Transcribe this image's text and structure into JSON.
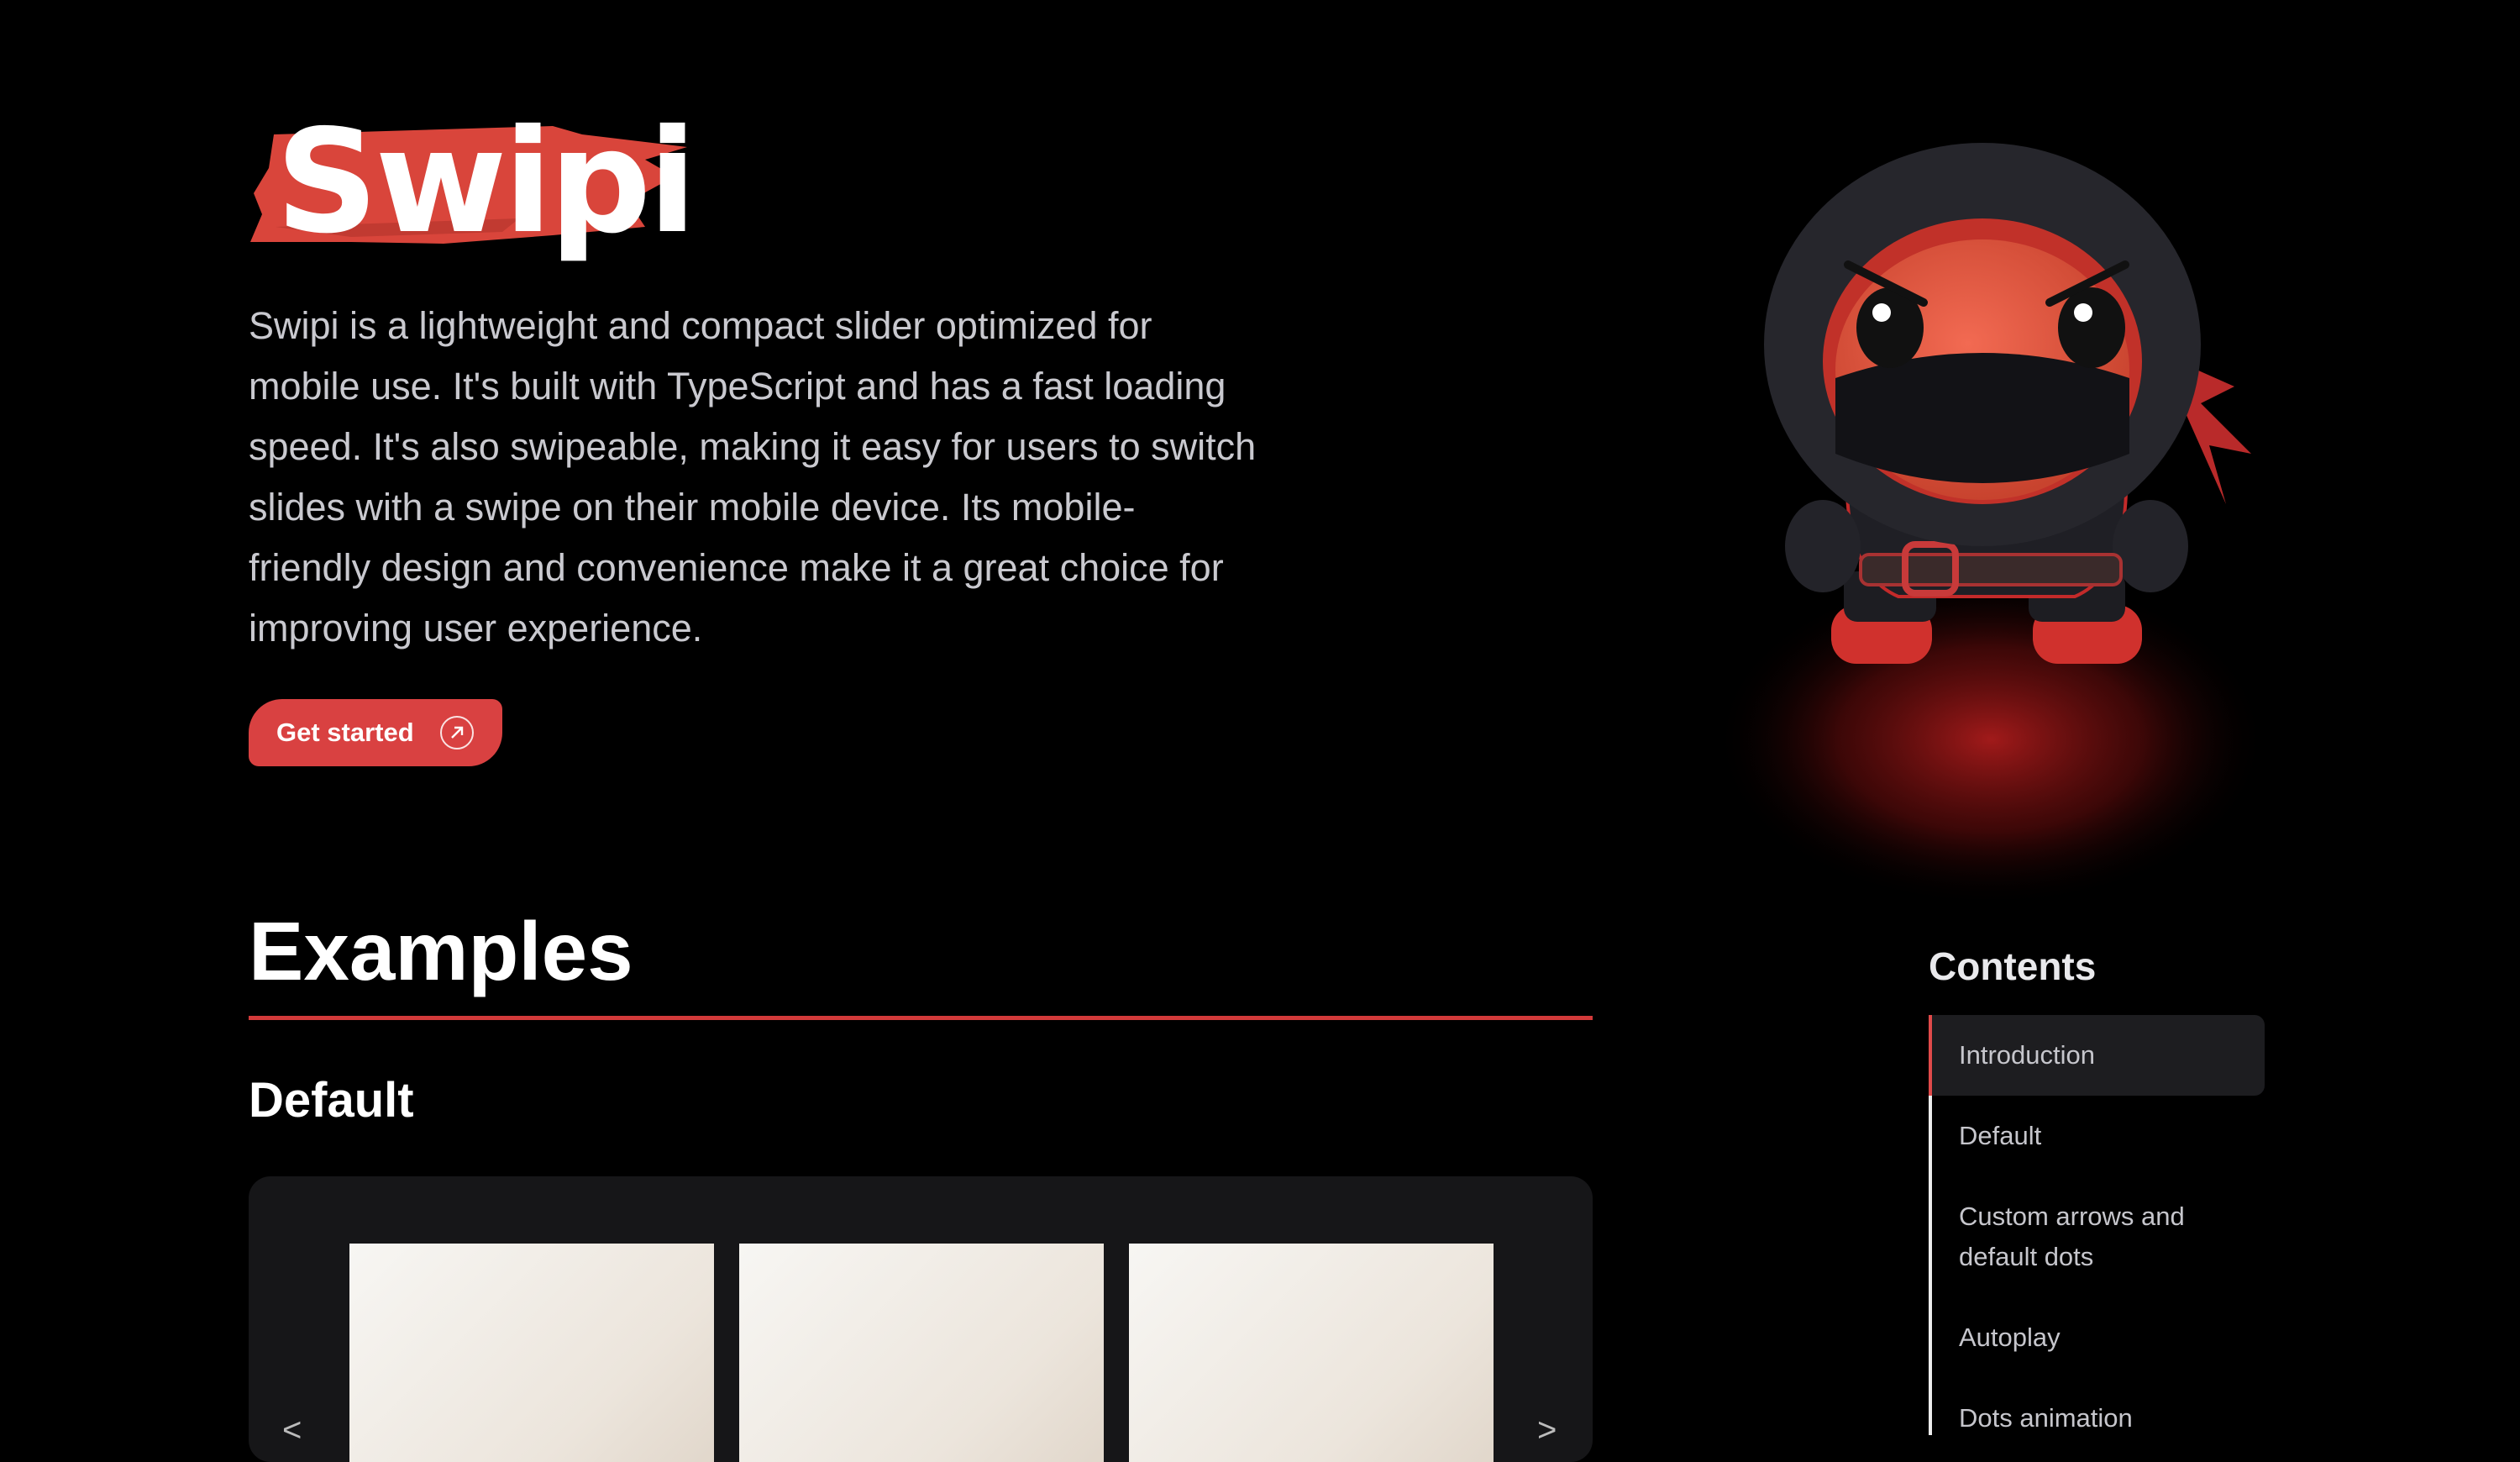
{
  "logo": {
    "text": "Swipi",
    "color": "#d9453b"
  },
  "intro": {
    "text": "Swipi is a lightweight and compact slider optimized for mobile use. It's built with TypeScript and has a fast loading speed. It's also swipeable, making it easy for users to switch slides with a swipe on their mobile device. Its mobile-friendly design and convenience make it a great choice for improving user experience."
  },
  "cta": {
    "label": "Get started",
    "icon": "arrow-up-right-icon",
    "color": "#d94141"
  },
  "examples": {
    "title": "Examples",
    "rule_color": "#d33a3a"
  },
  "sections": {
    "default_title": "Default"
  },
  "slider": {
    "prev_arrow": "<",
    "next_arrow": ">"
  },
  "contents": {
    "title": "Contents",
    "items": [
      {
        "label": "Introduction",
        "active": true
      },
      {
        "label": "Default"
      },
      {
        "label": "Custom arrows and default dots"
      },
      {
        "label": "Autoplay"
      },
      {
        "label": "Dots animation"
      }
    ]
  }
}
